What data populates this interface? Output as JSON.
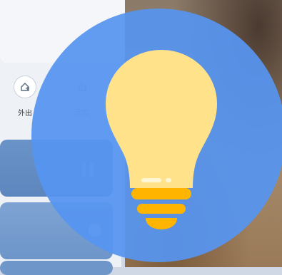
{
  "modes": [
    {
      "label": "外出",
      "icon": "away-home-icon"
    },
    {
      "label": "回家",
      "icon": "home-return-icon"
    }
  ],
  "tiles": [
    {
      "icon": "pause-icon"
    },
    {
      "icon": "toggle-dot-icon"
    }
  ],
  "overlay": {
    "icon": "light-bulb-icon",
    "circle_color": "#5694f0",
    "bulb_color": "#ffe28a",
    "base_color": "#ffb400"
  }
}
